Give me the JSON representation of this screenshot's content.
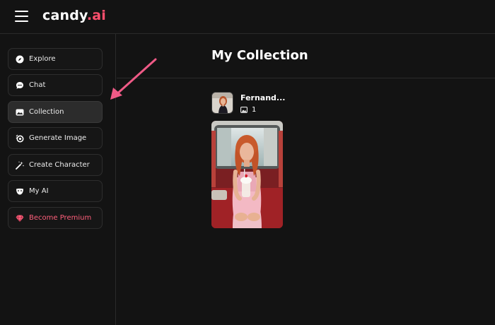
{
  "header": {
    "logo_main": "candy",
    "logo_accent": ".ai",
    "accent_color": "#ff4f6d",
    "menu_icon": "hamburger-icon"
  },
  "sidebar": {
    "items": [
      {
        "label": "Explore",
        "icon": "compass-icon"
      },
      {
        "label": "Chat",
        "icon": "chat-bubble-icon"
      },
      {
        "label": "Collection",
        "icon": "gallery-icon",
        "active": true
      },
      {
        "label": "Generate Image",
        "icon": "camera-icon"
      },
      {
        "label": "Create Character",
        "icon": "magic-wand-icon"
      },
      {
        "label": "My AI",
        "icon": "mask-icon"
      },
      {
        "label": "Become Premium",
        "icon": "diamond-icon",
        "color": "#ff5f7b"
      }
    ]
  },
  "main": {
    "title": "My Collection",
    "collection": [
      {
        "name": "Fernand...",
        "image_count": "1"
      }
    ]
  }
}
